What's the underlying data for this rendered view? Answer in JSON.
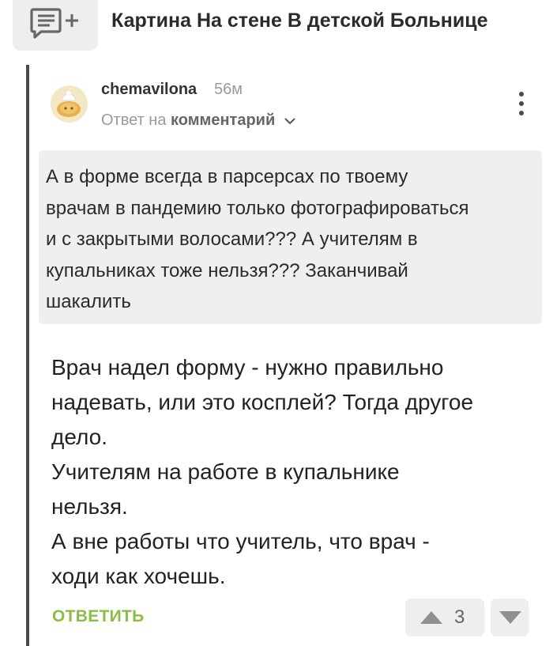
{
  "post": {
    "title": "Картина На стене В детской Больнице",
    "comment_button_icon": "comment-add-icon"
  },
  "comment": {
    "author": "chemavilona",
    "time": "56м",
    "reply_prefix": "Ответ на",
    "reply_target": "комментарий",
    "quote": "А в форме всегда в парсерсах по твоему\nврачам в пандемию только фотографироваться\nи с закрытыми волосами??? А учителям в\nкупальниках тоже нельзя??? Заканчивай\nшакалить",
    "text": "Врач надел форму - нужно правильно\nнадевать, или это косплей? Тогда другое\nдело.\nУчителям на работе в купальнике\nнельзя.\nА вне работы что учитель, что врач -\nходи как хочешь.",
    "reply_label": "ОТВЕТИТЬ",
    "rating": "3"
  },
  "colors": {
    "accent_green": "#8bbd45",
    "thread_line": "#4a4a4a",
    "quote_bg": "#efefef"
  }
}
